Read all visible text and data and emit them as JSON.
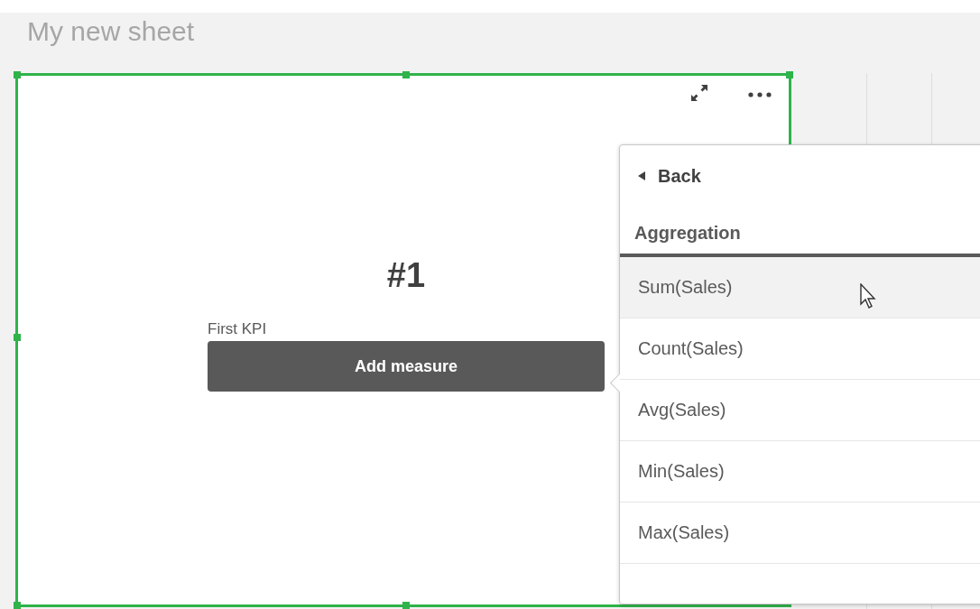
{
  "sheet": {
    "title": "My new sheet"
  },
  "kpi": {
    "value": "#1",
    "label": "First KPI",
    "button": "Add measure",
    "selected": true
  },
  "popover": {
    "back": "Back",
    "heading": "Aggregation",
    "items": [
      {
        "label": "Sum(Sales)",
        "selected": true
      },
      {
        "label": "Count(Sales)",
        "selected": false
      },
      {
        "label": "Avg(Sales)",
        "selected": false
      },
      {
        "label": "Min(Sales)",
        "selected": false
      },
      {
        "label": "Max(Sales)",
        "selected": false
      }
    ]
  }
}
